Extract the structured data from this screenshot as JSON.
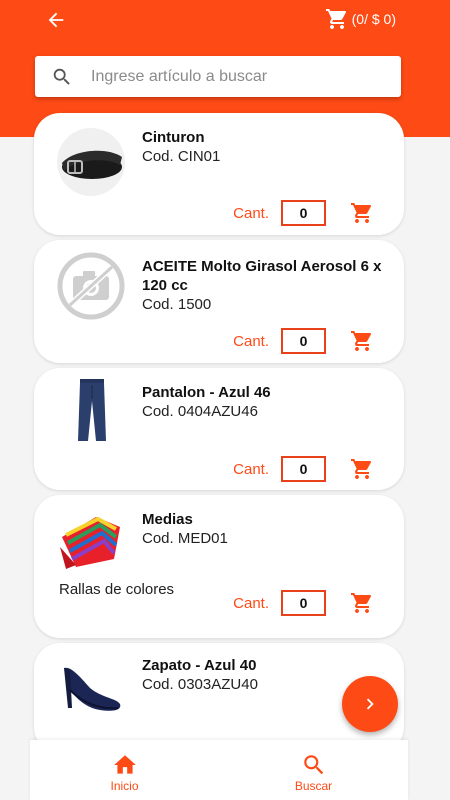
{
  "colors": {
    "brand": "#fe4a15",
    "background": "#f4f4f4",
    "card": "#ffffff"
  },
  "header": {
    "back_icon": "arrow-left-icon",
    "cart_icon": "shopping-cart-icon",
    "cart_summary": "(0/ $ 0)"
  },
  "search": {
    "icon": "search-icon",
    "placeholder": "Ingrese artículo a buscar",
    "value": ""
  },
  "products": [
    {
      "title": "Cinturon",
      "code": "Cod. CIN01",
      "qty_label": "Cant.",
      "qty": "0",
      "image": "belt-image"
    },
    {
      "title": "ACEITE Molto Girasol Aerosol 6 x 120 cc",
      "code": "Cod. 1500",
      "qty_label": "Cant.",
      "qty": "0",
      "image": "no-image-placeholder"
    },
    {
      "title": "Pantalon - Azul 46",
      "code": "Cod. 0404AZU46",
      "qty_label": "Cant.",
      "qty": "0",
      "image": "pants-image"
    },
    {
      "title": "Medias",
      "code": "Cod. MED01",
      "description": "Rallas de colores",
      "qty_label": "Cant.",
      "qty": "0",
      "image": "socks-image"
    },
    {
      "title": "Zapato - Azul 40",
      "code": "Cod. 0303AZU40",
      "image": "shoe-image"
    }
  ],
  "fab": {
    "icon": "chevron-right-icon"
  },
  "bottom_nav": [
    {
      "label": "Inicio",
      "icon": "home-icon"
    },
    {
      "label": "Buscar",
      "icon": "search-icon"
    }
  ]
}
